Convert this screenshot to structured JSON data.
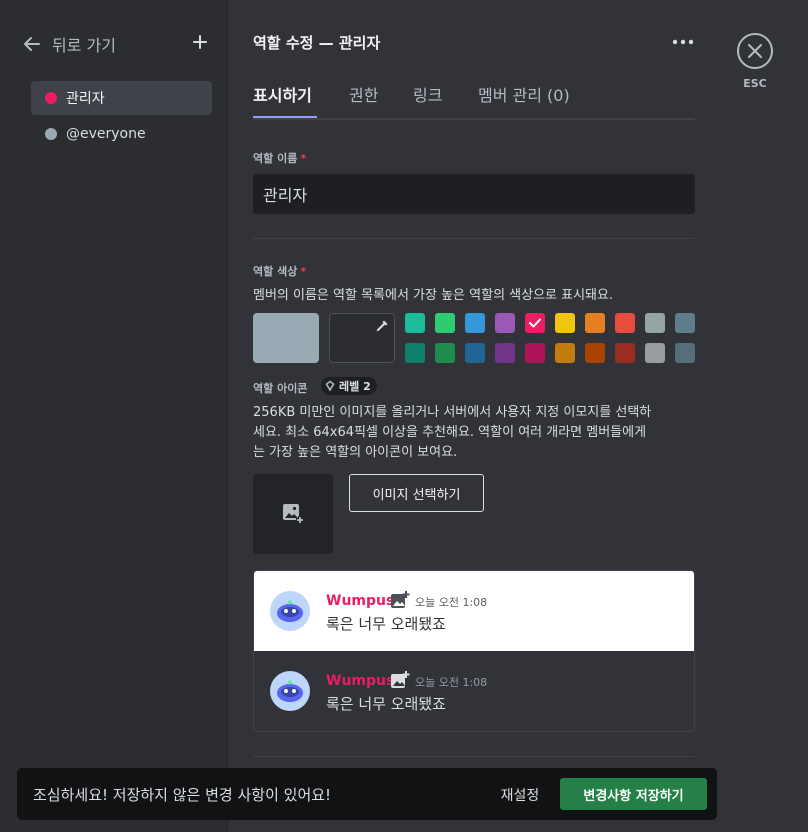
{
  "sidebar": {
    "back_label": "뒤로 가기",
    "back_icon": "arrow-left-icon",
    "add_icon": "plus-icon",
    "roles": [
      {
        "name": "관리자",
        "color": "#e91e63",
        "active": true
      },
      {
        "name": "@everyone",
        "color": "#99aab5",
        "active": false
      }
    ]
  },
  "header": {
    "title": "역할 수정 — 관리자",
    "more_icon": "more-dots-icon"
  },
  "tabs": [
    {
      "label": "표시하기",
      "active": true
    },
    {
      "label": "권한",
      "active": false
    },
    {
      "label": "링크",
      "active": false
    },
    {
      "label": "멤버 관리 (0)",
      "active": false
    }
  ],
  "role_name": {
    "label": "역할 이름",
    "required_mark": "*",
    "value": "관리자"
  },
  "role_color": {
    "label": "역할 색상",
    "required_mark": "*",
    "description": "멤버의 이름은 역할 목록에서 가장 높은 역할의 색상으로 표시돼요.",
    "default_color": "#99aab5",
    "picker_icon": "eyedropper-icon",
    "selected": "#e91e63",
    "swatches_top": [
      "#1abc9c",
      "#2ecc71",
      "#3498db",
      "#9b59b6",
      "#e91e63",
      "#f1c40f",
      "#e67e22",
      "#e74c3c",
      "#95a5a6",
      "#607d8b"
    ],
    "swatches_bottom": [
      "#11806a",
      "#1f8b4c",
      "#206694",
      "#71368a",
      "#ad1457",
      "#c27c0e",
      "#a84300",
      "#992d22",
      "#979c9f",
      "#546e7a"
    ]
  },
  "role_icon": {
    "label": "역할 아이콘",
    "badge_icon": "boost-gem-icon",
    "badge_text": "레벨 2",
    "description_lines": [
      "256KB 미만인 이미지를 올리거나 서버에서 사용자 지정 이모지를 선택하",
      "세요. 최소 64x64픽셀 이상을 추천해요. 역할이 여러 개라면 멤버들에게",
      "는 가장 높은 역할의 아이콘이 보여요."
    ],
    "upload_icon": "image-add-icon",
    "select_button": "이미지 선택하기"
  },
  "preview": {
    "messages": [
      {
        "theme": "light",
        "username": "Wumpus",
        "time": "오늘 오전 1:08",
        "text": "록은 너무 오래됐죠"
      },
      {
        "theme": "dark",
        "username": "Wumpus",
        "time": "오늘 오전 1:08",
        "text": "록은 너무 오래됐죠"
      }
    ],
    "name_color": "#e91e63"
  },
  "close": {
    "icon": "close-icon",
    "label": "ESC"
  },
  "notice": {
    "text": "조심하세요! 저장하지 않은 변경 사항이 있어요!",
    "reset_label": "재설정",
    "save_label": "변경사항 저장하기"
  }
}
